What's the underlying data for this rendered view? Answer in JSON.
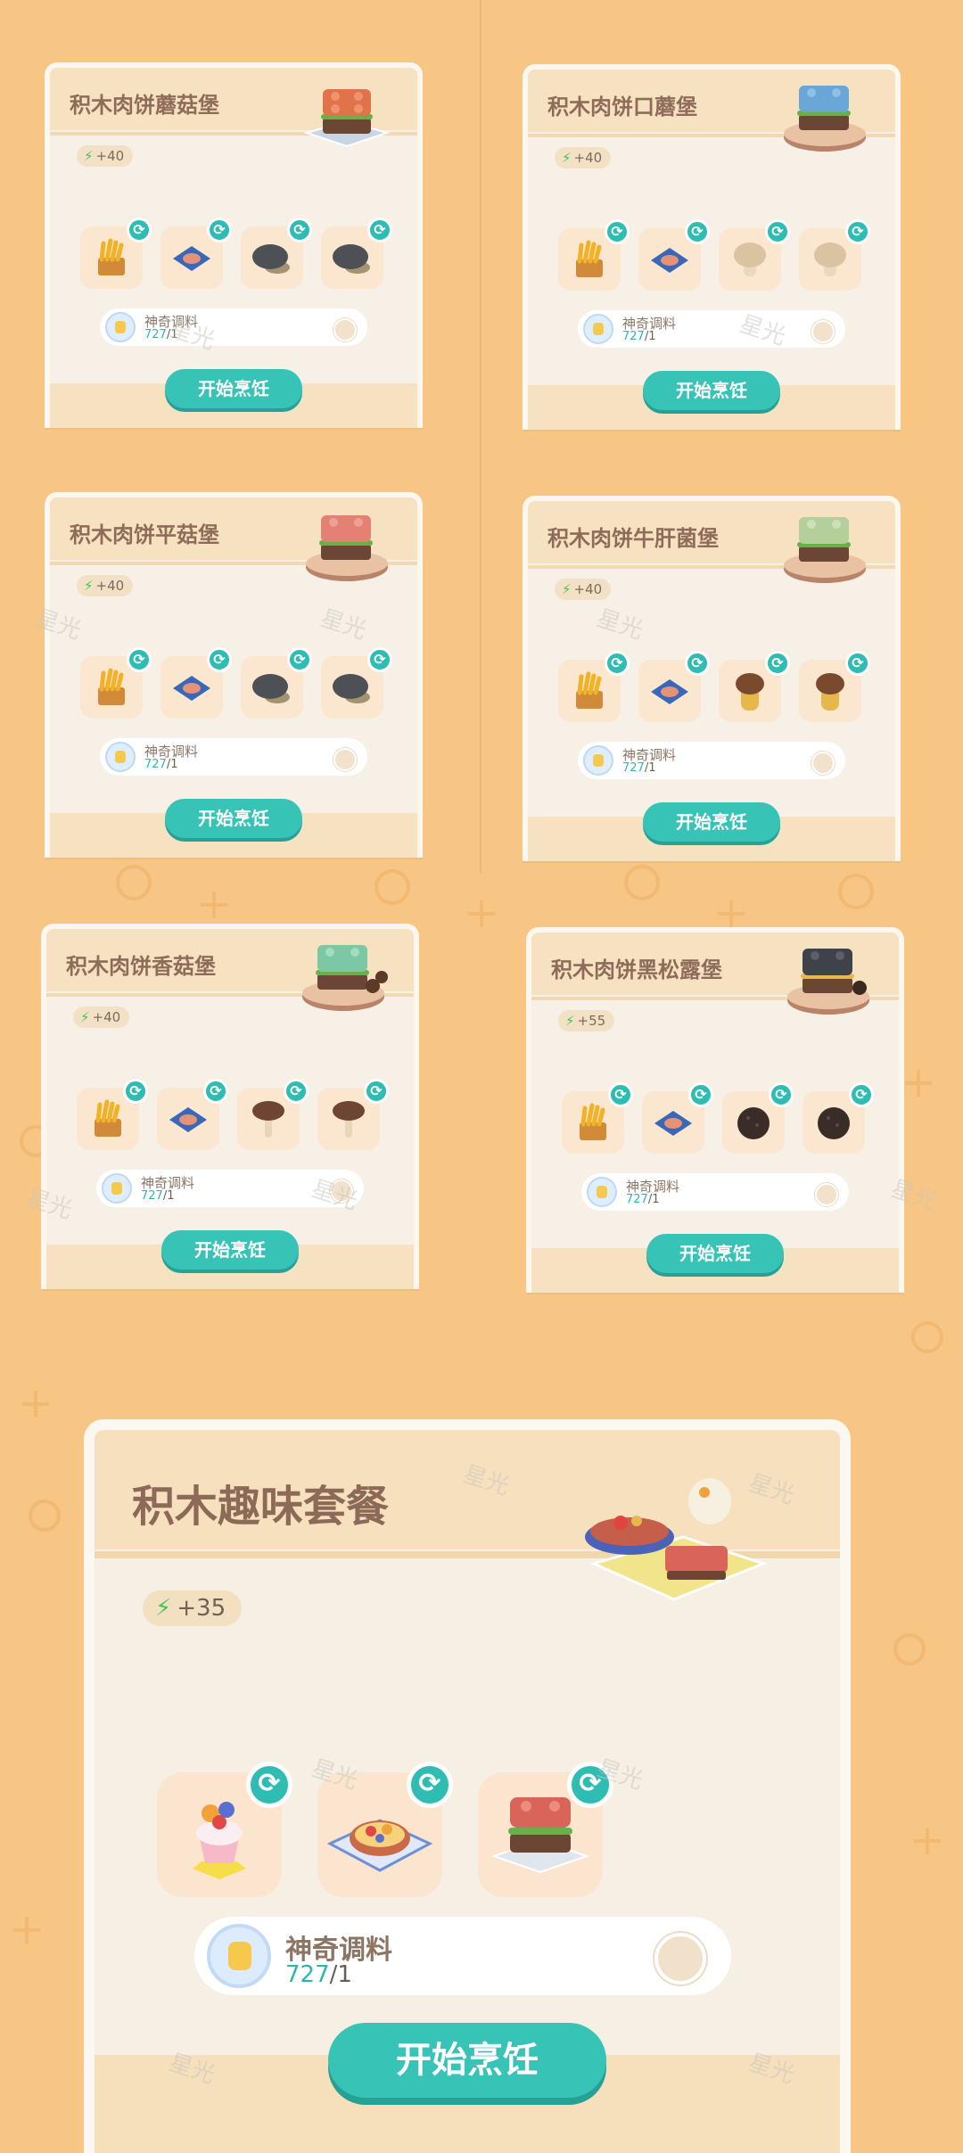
{
  "ui": {
    "cook_label": "开始烹饪",
    "seasoning_name": "神奇调料",
    "seasoning_have": "727",
    "seasoning_need": "/1",
    "watermark": "星光"
  },
  "cards": [
    {
      "title": "积木肉饼蘑菇堡",
      "energy": "+40",
      "bun_color": "#e0734a",
      "ingredients": [
        "fries",
        "meat-patty-tile",
        "dark-mushroom",
        "dark-mushroom"
      ]
    },
    {
      "title": "积木肉饼口蘑堡",
      "energy": "+40",
      "bun_color": "#6aa6d6",
      "ingredients": [
        "fries",
        "meat-patty-tile",
        "button-mushroom",
        "button-mushroom"
      ]
    },
    {
      "title": "积木肉饼平菇堡",
      "energy": "+40",
      "bun_color": "#e48074",
      "ingredients": [
        "fries",
        "meat-patty-tile",
        "dark-mushroom",
        "dark-mushroom"
      ]
    },
    {
      "title": "积木肉饼牛肝菌堡",
      "energy": "+40",
      "bun_color": "#b5cf9a",
      "ingredients": [
        "fries",
        "meat-patty-tile",
        "porcini",
        "porcini"
      ]
    },
    {
      "title": "积木肉饼香菇堡",
      "energy": "+40",
      "bun_color": "#7cc7a4",
      "ingredients": [
        "fries",
        "meat-patty-tile",
        "shiitake",
        "shiitake"
      ]
    },
    {
      "title": "积木肉饼黑松露堡",
      "energy": "+55",
      "bun_color": "#3f4248",
      "ingredients": [
        "fries",
        "meat-patty-tile",
        "truffle",
        "truffle"
      ]
    }
  ],
  "set_meal": {
    "title": "积木趣味套餐",
    "energy": "+35",
    "ingredients": [
      "fruit-cupcake",
      "fruit-tart",
      "block-burger"
    ]
  },
  "colors": {
    "accent": "#37c3b6",
    "background": "#f7c684",
    "card_head": "#f6e1c1",
    "energy_bolt": "#44c25a"
  }
}
